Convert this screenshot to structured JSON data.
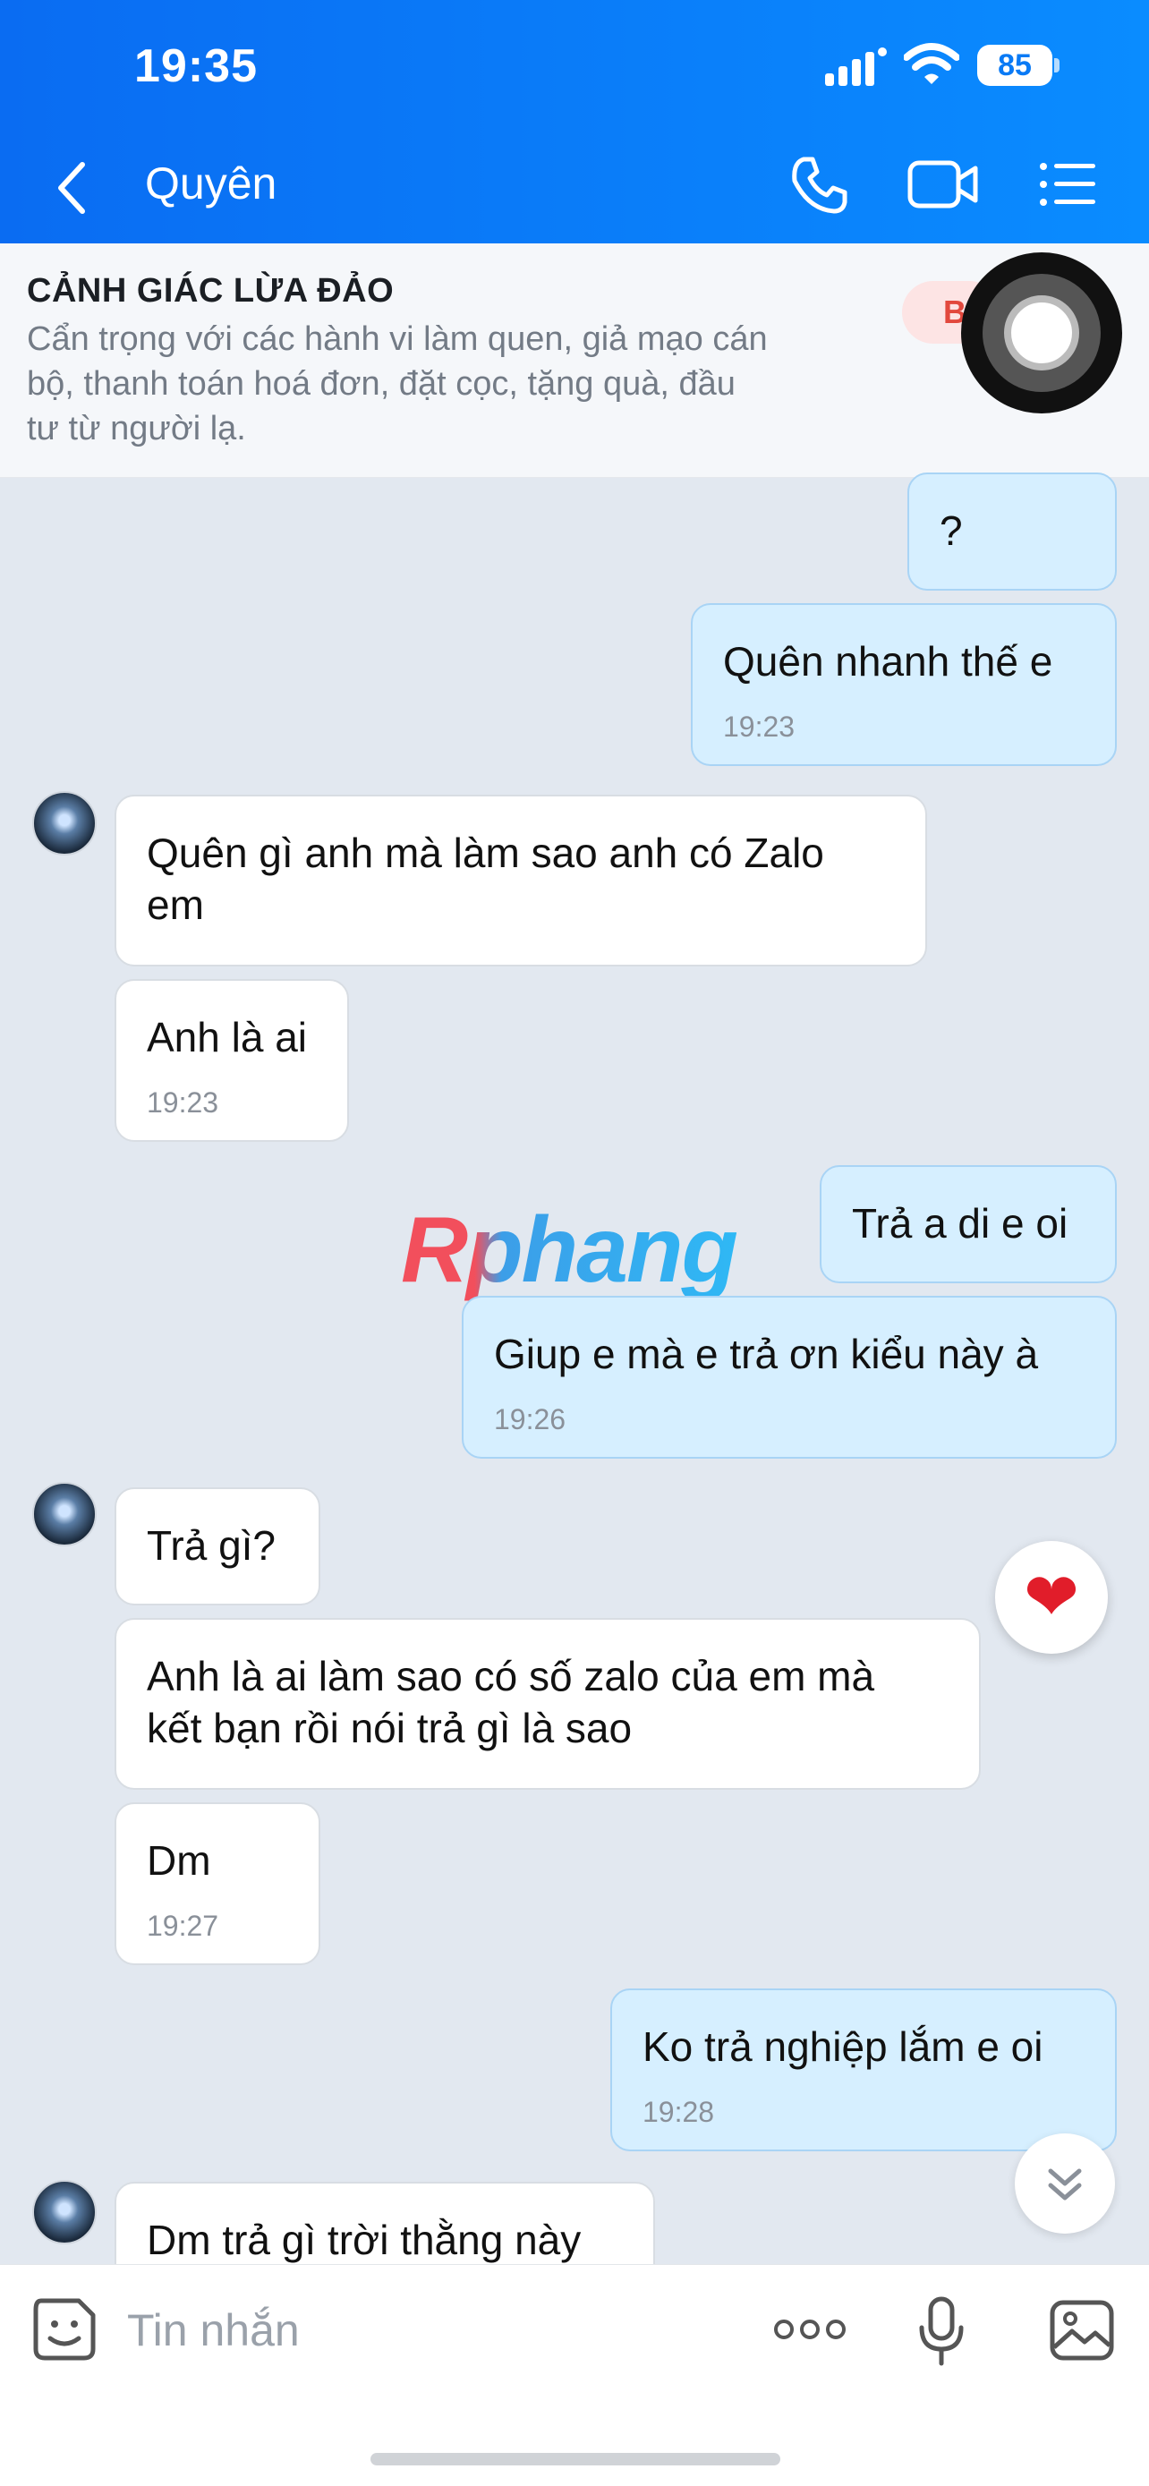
{
  "status_bar": {
    "time": "19:35",
    "battery": "85"
  },
  "header": {
    "title": "Quyên"
  },
  "banner": {
    "title": "CẢNH GIÁC LỪA ĐẢO",
    "lines": [
      "Cẩn trọng với các hành vi làm quen, giả mạo cán",
      "bộ, thanh toán hoá đơn, đặt cọc, tặng quà, đầu",
      "tư từ người lạ."
    ],
    "button_label": "B"
  },
  "watermark": "Rphang",
  "messages": [
    {
      "side": "out",
      "lines": [
        "?"
      ]
    },
    {
      "side": "out",
      "lines": [
        "Quên nhanh thế e"
      ],
      "time": "19:23"
    },
    {
      "side": "in",
      "lines": [
        "Quên gì anh mà làm sao anh có Zalo",
        "em"
      ]
    },
    {
      "side": "in",
      "lines": [
        "Anh là ai"
      ],
      "time": "19:23"
    },
    {
      "side": "out",
      "lines": [
        "Trả a di e oi"
      ]
    },
    {
      "side": "out",
      "lines": [
        "Giup e mà e trả ơn kiểu này à"
      ],
      "time": "19:26"
    },
    {
      "side": "in",
      "lines": [
        "Trả gì?"
      ]
    },
    {
      "side": "in",
      "lines": [
        "Anh là ai làm sao có số zalo của em mà",
        "kết bạn rồi nói trả gì là sao"
      ]
    },
    {
      "side": "in",
      "lines": [
        "Dm"
      ],
      "time": "19:27"
    },
    {
      "side": "out",
      "lines": [
        "Ko trả nghiệp lắm e oi"
      ],
      "time": "19:28"
    },
    {
      "side": "in",
      "lines": [
        "Dm trả gì trời thằng này"
      ]
    }
  ],
  "reaction": "❤",
  "input": {
    "placeholder": "Tin nhắn"
  },
  "colors": {
    "header": "#0a7af5",
    "out_bubble": "#d6efff",
    "in_bubble": "#ffffff",
    "chat_bg": "#e2e8f0"
  }
}
